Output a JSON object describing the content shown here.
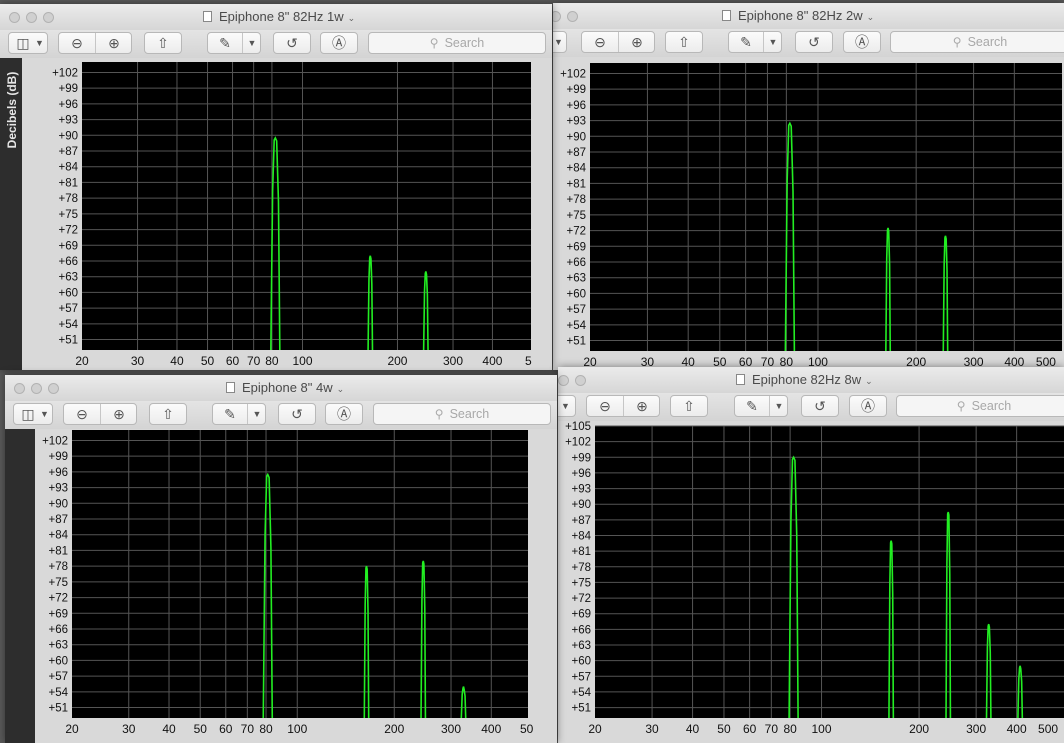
{
  "toolbar": {
    "search_placeholder": "Search",
    "icons": [
      "sidebar-icon",
      "chevron-down-icon",
      "zoom-out-icon",
      "zoom-in-icon",
      "share-icon",
      "markup-icon",
      "rotate-icon",
      "annotate-icon",
      "search-icon"
    ]
  },
  "windows": [
    {
      "title": "Epiphone 8\" 82Hz 1w",
      "ylabel": "Decibels (dB)"
    },
    {
      "title": "Epiphone 8\" 82Hz 2w"
    },
    {
      "title": "Epiphone 8\" 4w"
    },
    {
      "title": "Epiphone 82Hz 8w"
    }
  ],
  "colors": {
    "plot_bg": "#000000",
    "trace": "#22ee22",
    "grid": "#555555",
    "frame_bg": "#2d2d2d",
    "tick_label_bg": "#d9d9d9"
  },
  "chart_data": [
    {
      "type": "line",
      "x_scale": "log",
      "xlabel": "",
      "ylabel": "Decibels (dB)",
      "x_ticks": [
        "20",
        "30",
        "40",
        "50",
        "60",
        "70",
        "80",
        "100",
        "200",
        "300",
        "400",
        "5"
      ],
      "y_ticks": [
        "+102",
        "+99",
        "+96",
        "+93",
        "+90",
        "+87",
        "+84",
        "+81",
        "+78",
        "+75",
        "+72",
        "+69",
        "+66",
        "+63",
        "+60",
        "+57",
        "+54",
        "+51"
      ],
      "ylim": [
        49,
        104
      ],
      "xlim": [
        20,
        530
      ],
      "grid": true,
      "series": [
        {
          "peaks": [
            {
              "x": 82,
              "y": 89.5
            },
            {
              "x": 164,
              "y": 67
            },
            {
              "x": 246,
              "y": 64
            }
          ]
        }
      ]
    },
    {
      "type": "line",
      "x_scale": "log",
      "xlabel": "",
      "ylabel": "",
      "x_ticks": [
        "20",
        "30",
        "40",
        "50",
        "60",
        "70",
        "80",
        "100",
        "200",
        "300",
        "400",
        "500"
      ],
      "y_ticks": [
        "+102",
        "+99",
        "+96",
        "+93",
        "+90",
        "+87",
        "+84",
        "+81",
        "+78",
        "+75",
        "+72",
        "+69",
        "+66",
        "+63",
        "+60",
        "+57",
        "+54",
        "+51"
      ],
      "ylim": [
        49,
        104
      ],
      "xlim": [
        20,
        560
      ],
      "grid": true,
      "series": [
        {
          "peaks": [
            {
              "x": 82,
              "y": 92.5
            },
            {
              "x": 164,
              "y": 72.5
            },
            {
              "x": 246,
              "y": 71
            }
          ]
        }
      ]
    },
    {
      "type": "line",
      "x_scale": "log",
      "xlabel": "",
      "ylabel": "",
      "x_ticks": [
        "20",
        "30",
        "40",
        "50",
        "60",
        "70",
        "80",
        "100",
        "200",
        "300",
        "400",
        "50"
      ],
      "y_ticks": [
        "+102",
        "+99",
        "+96",
        "+93",
        "+90",
        "+87",
        "+84",
        "+81",
        "+78",
        "+75",
        "+72",
        "+69",
        "+66",
        "+63",
        "+60",
        "+57",
        "+54",
        "+51"
      ],
      "ylim": [
        49,
        104
      ],
      "xlim": [
        20,
        520
      ],
      "grid": true,
      "series": [
        {
          "peaks": [
            {
              "x": 81,
              "y": 95.5
            },
            {
              "x": 164,
              "y": 78
            },
            {
              "x": 246,
              "y": 79
            },
            {
              "x": 328,
              "y": 55
            }
          ]
        }
      ]
    },
    {
      "type": "line",
      "x_scale": "log",
      "xlabel": "",
      "ylabel": "",
      "x_ticks": [
        "20",
        "30",
        "40",
        "50",
        "60",
        "70",
        "80",
        "100",
        "200",
        "300",
        "400",
        "500"
      ],
      "y_ticks": [
        "+105",
        "+102",
        "+99",
        "+96",
        "+93",
        "+90",
        "+87",
        "+84",
        "+81",
        "+78",
        "+75",
        "+72",
        "+69",
        "+66",
        "+63",
        "+60",
        "+57",
        "+54",
        "+51"
      ],
      "ylim": [
        49,
        105
      ],
      "xlim": [
        20,
        560
      ],
      "grid": true,
      "series": [
        {
          "peaks": [
            {
              "x": 82,
              "y": 99
            },
            {
              "x": 164,
              "y": 83
            },
            {
              "x": 246,
              "y": 88.5
            },
            {
              "x": 328,
              "y": 67
            },
            {
              "x": 410,
              "y": 59
            }
          ]
        }
      ]
    }
  ]
}
